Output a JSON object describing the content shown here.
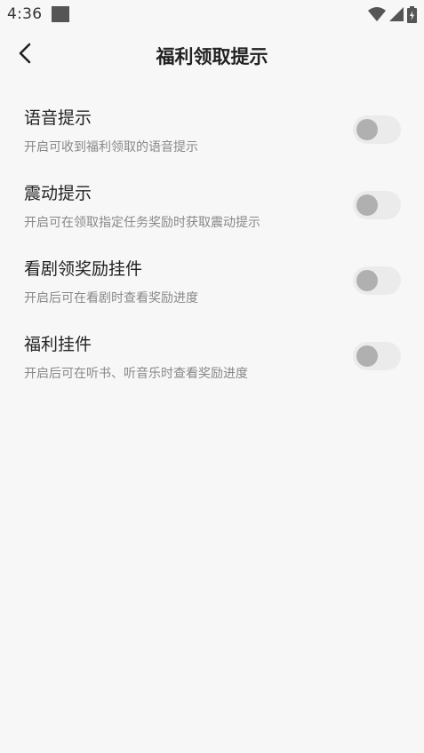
{
  "status_bar": {
    "time": "4:36",
    "icons": [
      "wifi-icon",
      "signal-icon",
      "battery-charging-icon"
    ]
  },
  "header": {
    "title": "福利领取提示",
    "back_icon": "chevron-left-icon"
  },
  "settings": [
    {
      "title": "语音提示",
      "description": "开启可收到福利领取的语音提示",
      "enabled": false
    },
    {
      "title": "震动提示",
      "description": "开启可在领取指定任务奖励时获取震动提示",
      "enabled": false
    },
    {
      "title": "看剧领奖励挂件",
      "description": "开启后可在看剧时查看奖励进度",
      "enabled": false
    },
    {
      "title": "福利挂件",
      "description": "开启后可在听书、听音乐时查看奖励进度",
      "enabled": false
    }
  ],
  "colors": {
    "background": "#f7f7f7",
    "toggle_track_off": "#ebebeb",
    "toggle_knob_off": "#b0b0b0"
  }
}
